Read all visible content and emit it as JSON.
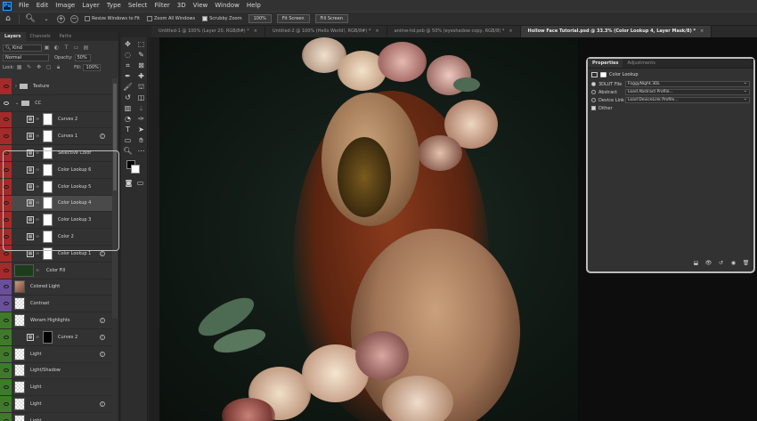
{
  "menubar": {
    "logo": "Ps",
    "items": [
      "File",
      "Edit",
      "Image",
      "Layer",
      "Type",
      "Select",
      "Filter",
      "3D",
      "View",
      "Window",
      "Help"
    ]
  },
  "options_bar": {
    "resize_windows": "Resize Windows to Fit",
    "zoom_all_windows": "Zoom All Windows",
    "scrubby_zoom": "Scrubby Zoom",
    "zoom_value": "100%",
    "fit_screen": "Fit Screen",
    "fill_screen": "Fill Screen"
  },
  "doc_tabs": [
    "Untitled-1 @ 100% (Layer 20, RGB/8#) *",
    "Untitled-2 @ 100% (Hello World!, RGB/8#) *",
    "anime-hd.psb @ 50% (eyeshadow copy, RGB/8) *",
    "Hollow Face Tutorial.psd @ 33.3% (Color Lookup 4, Layer Mask/8) *"
  ],
  "layers_panel": {
    "tabs": [
      "Layers",
      "Channels",
      "Paths"
    ],
    "kind_label": "Kind",
    "blend_mode": "Normal",
    "opacity_label": "Opacity:",
    "opacity_value": "50%",
    "lock_label": "Lock:",
    "fill_label": "Fill:",
    "fill_value": "100%",
    "layers": [
      {
        "name": "Texture",
        "eye": "red",
        "type": "folder-closed"
      },
      {
        "name": "CC",
        "eye": "none",
        "type": "folder-open"
      },
      {
        "name": "Curves 2",
        "eye": "red",
        "type": "adj"
      },
      {
        "name": "Curves 1",
        "eye": "red",
        "type": "adj",
        "fx": true
      },
      {
        "name": "Selective Color",
        "eye": "red",
        "type": "adj"
      },
      {
        "name": "Color Lookup 6",
        "eye": "red",
        "type": "adj"
      },
      {
        "name": "Color Lookup 5",
        "eye": "red",
        "type": "adj"
      },
      {
        "name": "Color Lookup 4",
        "eye": "red",
        "type": "adj",
        "selected": true
      },
      {
        "name": "Color Lookup 3",
        "eye": "red",
        "type": "adj"
      },
      {
        "name": "Color 2",
        "eye": "red",
        "type": "adj"
      },
      {
        "name": "Color Lookup 1",
        "eye": "red",
        "type": "adj",
        "fx": true
      },
      {
        "name": "Color Fill",
        "eye": "red",
        "type": "fill"
      },
      {
        "name": "Colored Light",
        "eye": "purple",
        "type": "photo"
      },
      {
        "name": "Contrast",
        "eye": "purple",
        "type": "pixel"
      },
      {
        "name": "Woram Highlights",
        "eye": "green",
        "type": "pixel",
        "fx": true
      },
      {
        "name": "Curves 2",
        "eye": "green",
        "type": "adj-black",
        "fx": true
      },
      {
        "name": "Light",
        "eye": "green",
        "type": "pixel",
        "fx": true
      },
      {
        "name": "Light/Shadow",
        "eye": "green",
        "type": "pixel"
      },
      {
        "name": "Light",
        "eye": "green",
        "type": "pixel"
      },
      {
        "name": "Light",
        "eye": "green",
        "type": "pixel",
        "fx": true
      },
      {
        "name": "Light",
        "eye": "green",
        "type": "pixel"
      }
    ]
  },
  "properties_panel": {
    "tabs": [
      "Properties",
      "Adjustments"
    ],
    "heading": "Color Lookup",
    "rows": [
      {
        "label": "3DLUT File",
        "value": "FoggyNight.3DL",
        "control": "radio-on"
      },
      {
        "label": "Abstract",
        "value": "Load Abstract Profile...",
        "control": "radio"
      },
      {
        "label": "Device Link",
        "value": "Load DeviceLink Profile...",
        "control": "radio"
      }
    ],
    "dither_label": "Dither"
  }
}
